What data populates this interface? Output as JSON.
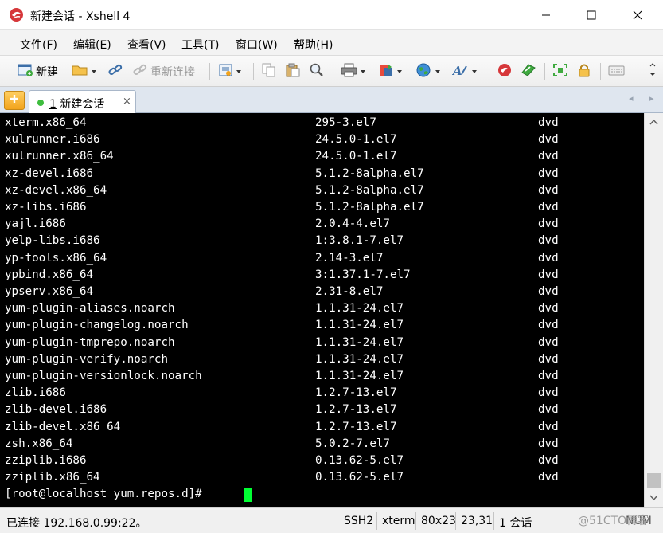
{
  "window": {
    "title": "新建会话 - Xshell 4"
  },
  "menu": {
    "items": [
      "文件(F)",
      "编辑(E)",
      "查看(V)",
      "工具(T)",
      "窗口(W)",
      "帮助(H)"
    ]
  },
  "toolbar": {
    "new_label": "新建",
    "reconnect_label": "重新连接"
  },
  "tabs": {
    "active_index": "1",
    "active_label": "新建会话",
    "close_glyph": "×"
  },
  "terminal": {
    "rows": [
      [
        "xterm.x86_64",
        "295-3.el7",
        "dvd"
      ],
      [
        "xulrunner.i686",
        "24.5.0-1.el7",
        "dvd"
      ],
      [
        "xulrunner.x86_64",
        "24.5.0-1.el7",
        "dvd"
      ],
      [
        "xz-devel.i686",
        "5.1.2-8alpha.el7",
        "dvd"
      ],
      [
        "xz-devel.x86_64",
        "5.1.2-8alpha.el7",
        "dvd"
      ],
      [
        "xz-libs.i686",
        "5.1.2-8alpha.el7",
        "dvd"
      ],
      [
        "yajl.i686",
        "2.0.4-4.el7",
        "dvd"
      ],
      [
        "yelp-libs.i686",
        "1:3.8.1-7.el7",
        "dvd"
      ],
      [
        "yp-tools.x86_64",
        "2.14-3.el7",
        "dvd"
      ],
      [
        "ypbind.x86_64",
        "3:1.37.1-7.el7",
        "dvd"
      ],
      [
        "ypserv.x86_64",
        "2.31-8.el7",
        "dvd"
      ],
      [
        "yum-plugin-aliases.noarch",
        "1.1.31-24.el7",
        "dvd"
      ],
      [
        "yum-plugin-changelog.noarch",
        "1.1.31-24.el7",
        "dvd"
      ],
      [
        "yum-plugin-tmprepo.noarch",
        "1.1.31-24.el7",
        "dvd"
      ],
      [
        "yum-plugin-verify.noarch",
        "1.1.31-24.el7",
        "dvd"
      ],
      [
        "yum-plugin-versionlock.noarch",
        "1.1.31-24.el7",
        "dvd"
      ],
      [
        "zlib.i686",
        "1.2.7-13.el7",
        "dvd"
      ],
      [
        "zlib-devel.i686",
        "1.2.7-13.el7",
        "dvd"
      ],
      [
        "zlib-devel.x86_64",
        "1.2.7-13.el7",
        "dvd"
      ],
      [
        "zsh.x86_64",
        "5.0.2-7.el7",
        "dvd"
      ],
      [
        "zziplib.i686",
        "0.13.62-5.el7",
        "dvd"
      ],
      [
        "zziplib.x86_64",
        "0.13.62-5.el7",
        "dvd"
      ]
    ],
    "prompt": "[root@localhost yum.repos.d]# "
  },
  "status": {
    "connection": "已连接 192.168.0.99:22。",
    "protocol": "SSH2",
    "terminal_type": "xterm",
    "size": "80x23",
    "cursor_position": "23,31",
    "sessions": "1 会话",
    "num_lock": "NUM",
    "watermark": "@51CTO博客"
  },
  "colors": {
    "terminal_bg": "#000000",
    "terminal_fg": "#ffffff",
    "cursor": "#00ff33",
    "tab_dot": "#3ebd3e"
  }
}
